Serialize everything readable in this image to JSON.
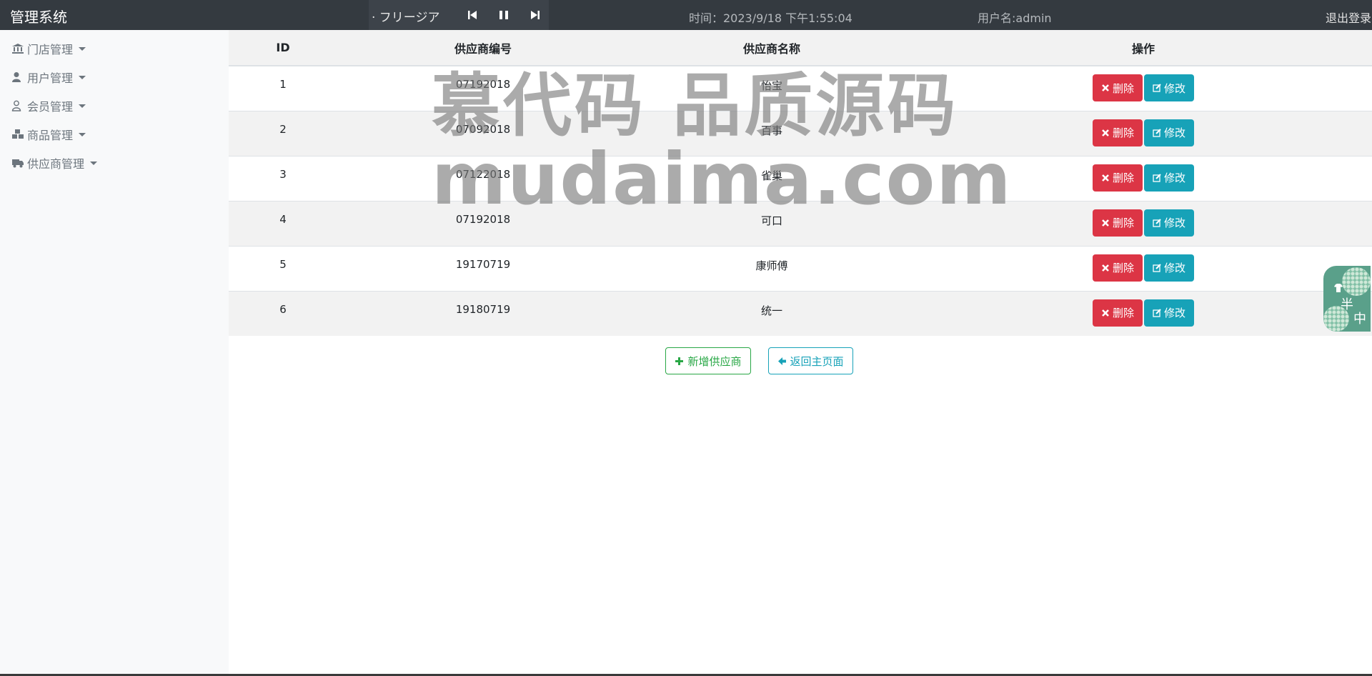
{
  "header": {
    "brand": "管理系统",
    "player": {
      "song": "· フリージア",
      "prev_icon": "skip-back-icon",
      "pause_icon": "pause-icon",
      "next_icon": "skip-forward-icon"
    },
    "clock": "时间：2023/9/18 下午1:55:04",
    "username": "用户名:admin",
    "logout": "退出登录"
  },
  "sidebar": {
    "items": [
      {
        "label": "门店管理",
        "icon": "bank-icon"
      },
      {
        "label": "用户管理",
        "icon": "user-icon"
      },
      {
        "label": "会员管理",
        "icon": "user-outline-icon"
      },
      {
        "label": "商品管理",
        "icon": "cubes-icon"
      },
      {
        "label": "供应商管理",
        "icon": "truck-icon"
      }
    ]
  },
  "table": {
    "headers": [
      "ID",
      "供应商编号",
      "供应商名称",
      "操作"
    ],
    "rows": [
      {
        "id": "1",
        "code": "07192018",
        "name": "怡宝"
      },
      {
        "id": "2",
        "code": "07092018",
        "name": "百事"
      },
      {
        "id": "3",
        "code": "07122018",
        "name": "雀巢"
      },
      {
        "id": "4",
        "code": "07192018",
        "name": "可口"
      },
      {
        "id": "5",
        "code": "19170719",
        "name": "康师傅"
      },
      {
        "id": "6",
        "code": "19180719",
        "name": "统一"
      }
    ],
    "delete_label": "删除",
    "edit_label": "修改"
  },
  "actions": {
    "add_label": "新增供应商",
    "back_label": "返回主页面"
  },
  "watermark": {
    "line1": "慕代码 品质源码",
    "line2": "mudaima.com"
  },
  "ime": {
    "char1": "半",
    "char2": "中"
  },
  "colors": {
    "topbar": "#343a40",
    "danger": "#dc3545",
    "info": "#17a2b8",
    "success": "#28a745"
  }
}
